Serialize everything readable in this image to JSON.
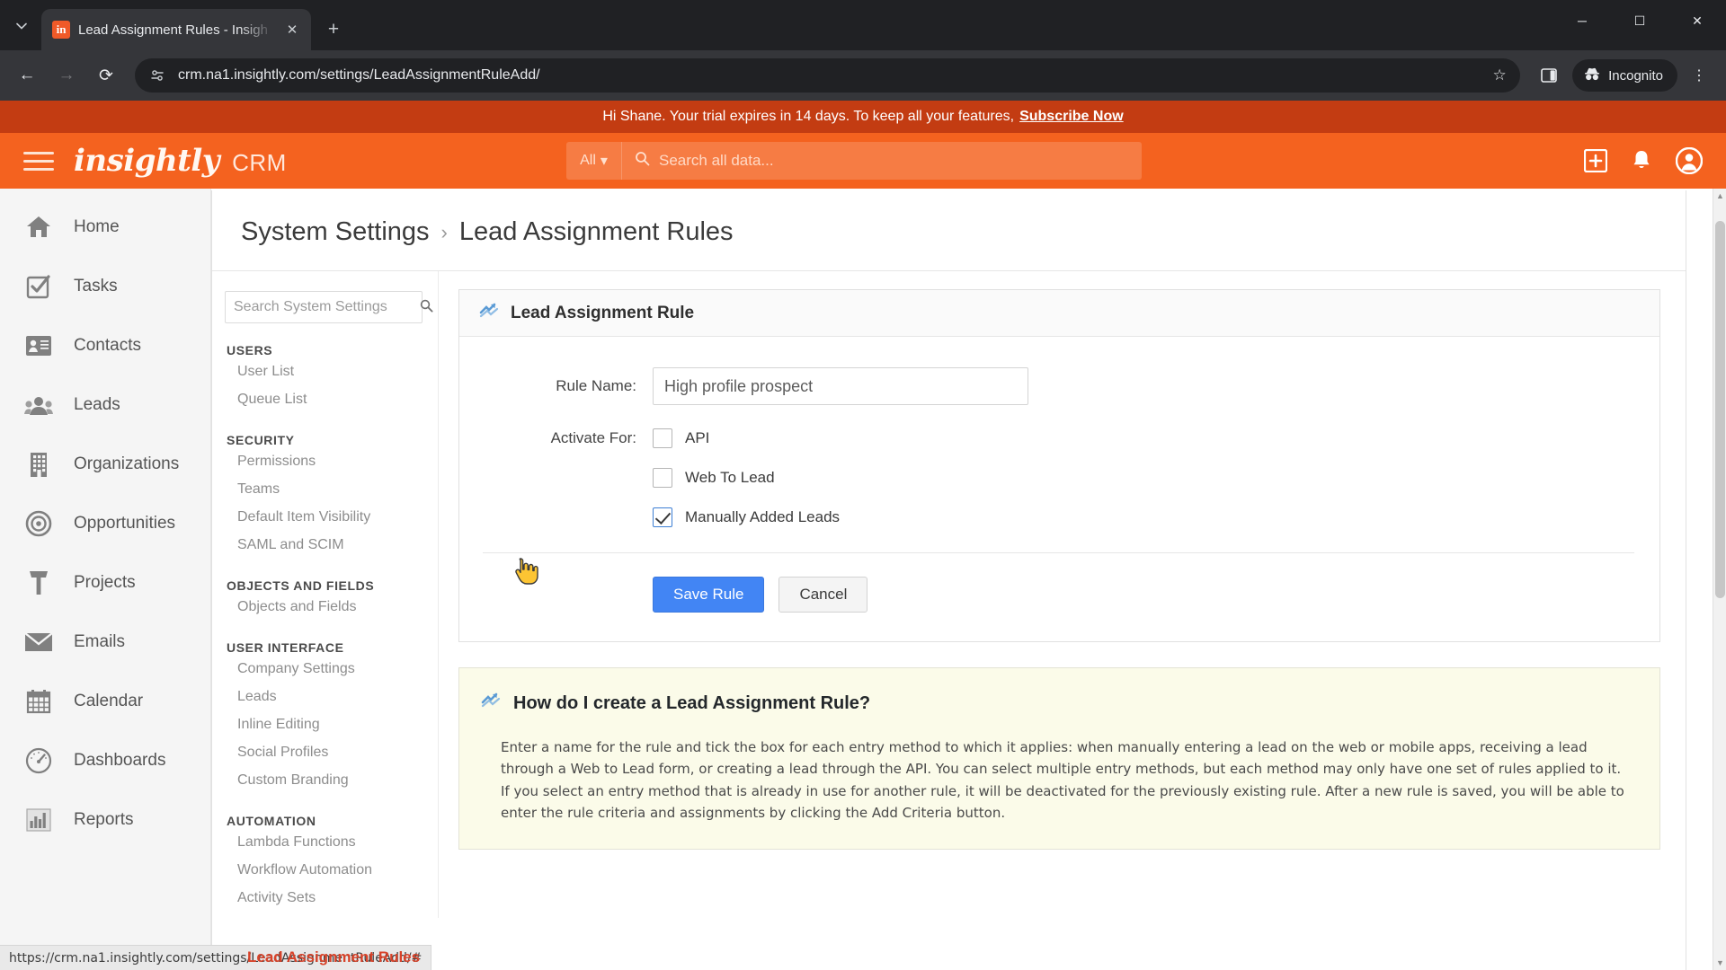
{
  "browser": {
    "tab": {
      "title": "Lead Assignment Rules - Insigh",
      "favicon_text": "in",
      "close_label": "✕"
    },
    "new_tab_label": "+",
    "tab_search_label": "⌄",
    "window_controls": {
      "minimize": "─",
      "maximize": "☐",
      "close": "✕"
    },
    "nav": {
      "back": "←",
      "forward": "→",
      "reload": "⟳"
    },
    "omnibox": {
      "url": "crm.na1.insightly.com/settings/LeadAssignmentRuleAdd/",
      "star_label": "☆"
    },
    "incognito_label": "Incognito",
    "menu_label": "⋮",
    "status_bubble": "https://crm.na1.insightly.com/settings/LeadAssignmentRuleAdd/#"
  },
  "trial_banner": {
    "message": "Hi Shane. Your trial expires in 14 days. To keep all your features,",
    "cta": "Subscribe Now"
  },
  "app_header": {
    "brand": "insightly",
    "brand_suffix": "CRM",
    "search": {
      "scope": "All",
      "scope_caret": "▾",
      "placeholder": "Search all data...",
      "value": ""
    },
    "actions": {
      "add": "+",
      "notifications": "bell",
      "profile": "account"
    }
  },
  "rail": {
    "items": [
      {
        "label": "Home",
        "icon": "home-icon"
      },
      {
        "label": "Tasks",
        "icon": "tasks-icon"
      },
      {
        "label": "Contacts",
        "icon": "contacts-icon"
      },
      {
        "label": "Leads",
        "icon": "leads-icon"
      },
      {
        "label": "Organizations",
        "icon": "organizations-icon"
      },
      {
        "label": "Opportunities",
        "icon": "opportunities-icon"
      },
      {
        "label": "Projects",
        "icon": "projects-icon"
      },
      {
        "label": "Emails",
        "icon": "emails-icon"
      },
      {
        "label": "Calendar",
        "icon": "calendar-icon"
      },
      {
        "label": "Dashboards",
        "icon": "dashboards-icon"
      },
      {
        "label": "Reports",
        "icon": "reports-icon"
      }
    ]
  },
  "breadcrumb": {
    "root": "System Settings",
    "separator": "›",
    "current": "Lead Assignment Rules"
  },
  "settings_nav": {
    "search_placeholder": "Search System Settings",
    "search_value": "",
    "groups": [
      {
        "heading": "USERS",
        "items": [
          "User List",
          "Queue List"
        ]
      },
      {
        "heading": "SECURITY",
        "items": [
          "Permissions",
          "Teams",
          "Default Item Visibility",
          "SAML and SCIM"
        ]
      },
      {
        "heading": "OBJECTS AND FIELDS",
        "items": [
          "Objects and Fields"
        ]
      },
      {
        "heading": "USER INTERFACE",
        "items": [
          "Company Settings",
          "Leads",
          "Inline Editing",
          "Social Profiles",
          "Custom Branding"
        ]
      },
      {
        "heading": "AUTOMATION",
        "items": [
          "Lambda Functions",
          "Workflow Automation",
          "Activity Sets"
        ]
      }
    ],
    "active_item": "Lead Assignment Rules"
  },
  "form_panel": {
    "title": "Lead Assignment Rule",
    "rule_name_label": "Rule Name:",
    "rule_name_value": "High profile prospect",
    "rule_name_placeholder": "",
    "activate_for_label": "Activate For:",
    "checkboxes": [
      {
        "label": "API",
        "checked": false
      },
      {
        "label": "Web To Lead",
        "checked": false
      },
      {
        "label": "Manually Added Leads",
        "checked": true
      }
    ],
    "save_label": "Save Rule",
    "cancel_label": "Cancel"
  },
  "help_panel": {
    "title": "How do I create a Lead Assignment Rule?",
    "body": "Enter a name for the rule and tick the box for each entry method to which it applies: when manually entering a lead on the web or mobile apps, receiving a lead through a Web to Lead form, or creating a lead through the API. You can select multiple entry methods, but each method may only have one set of rules applied to it. If you select an entry method that is already in use for another rule, it will be deactivated for the previously existing rule. After a new rule is saved, you will be able to enter the rule criteria and assignments by clicking the Add Criteria button."
  },
  "colors": {
    "brand_orange": "#f4621f",
    "banner_red": "#c33c12",
    "primary_blue": "#4285f4",
    "active_red": "#d8432a",
    "help_bg": "#fbfbe9"
  }
}
